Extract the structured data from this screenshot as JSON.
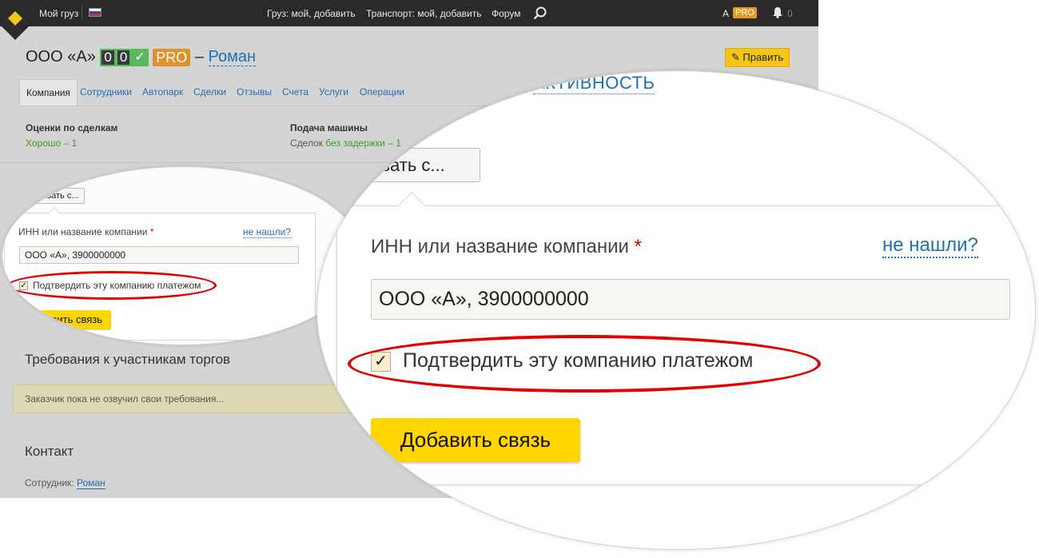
{
  "topbar": {
    "my_cargo": "Мой груз",
    "cargo_links": "Груз: мой, добавить",
    "transport_links": "Транспорт: мой, добавить",
    "forum": "Форум",
    "user_letter": "A",
    "pro": "PRO",
    "notifications": "0"
  },
  "company": {
    "name": "ООО «А»",
    "digit1": "0",
    "digit2": "0",
    "check": "✓",
    "pro": "PRO",
    "dash": "–",
    "owner": "Роман"
  },
  "edit_button": "Править",
  "tabs": [
    "Компания",
    "Сотрудники",
    "Автопарк",
    "Сделки",
    "Отзывы",
    "Счета",
    "Услуги",
    "Операции"
  ],
  "stats": {
    "deals_rating_title": "Оценки по сделкам",
    "deals_rating_value": "Хорошо – 1",
    "vehicle_title": "Подача машины",
    "vehicle_prefix": "Сделок",
    "vehicle_value": "без задержки – 1"
  },
  "requirements": {
    "title": "Требования к участникам торгов",
    "text": "Заказчик пока не озвучил свои требования..."
  },
  "contact": {
    "title": "Контакт",
    "employee_label": "Сотрудник:",
    "employee_name": "Роман"
  },
  "connect_form": {
    "connect_button": "Связать с...",
    "connect_button_cropped": "язать с...",
    "activity_link": "АКТИВНОСТЬ",
    "field_label": "ИНН или название компании",
    "required_mark": "*",
    "not_found": "не нашли?",
    "input_value": "ООО «А», 3900000000",
    "confirm_label": "Подтвердить эту компанию платежом",
    "confirm_checked": true,
    "add_button": "Добавить связь"
  },
  "colors": {
    "accent_link": "#1f6fb2",
    "button_yellow": "#ffd500",
    "highlight_ring": "#e20000",
    "good_green": "#3d9b1d",
    "pro_orange": "#e0922a"
  }
}
